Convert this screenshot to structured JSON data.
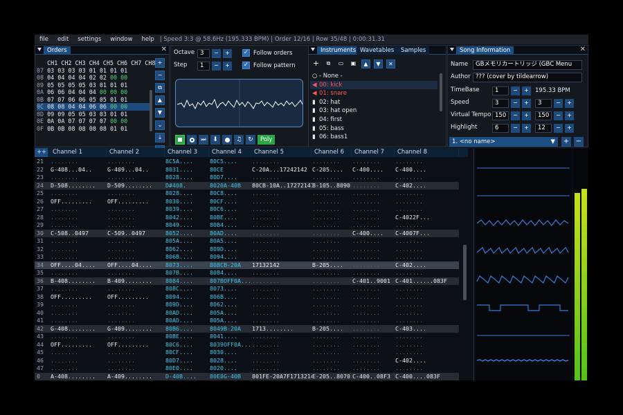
{
  "menu": {
    "items": [
      "file",
      "edit",
      "settings",
      "window",
      "help"
    ],
    "status": "| Speed 3:3 @ 58.6Hz (195.333 BPM) | Order 12/16 | Row 35/48 | 0:00:31.31"
  },
  "orders": {
    "tab": "Orders",
    "header": "   CH1 CH2 CH3 CH4 CH5 CH6 CH7 CH8",
    "rows": [
      [
        "07",
        "03",
        "03",
        "03",
        "03",
        "01",
        "01",
        "01",
        "01"
      ],
      [
        "08",
        "04",
        "04",
        "04",
        "04",
        "02",
        "02",
        "00",
        "00"
      ],
      [
        "09",
        "05",
        "05",
        "05",
        "05",
        "03",
        "01",
        "01",
        "01"
      ],
      [
        "0A",
        "06",
        "06",
        "04",
        "04",
        "04",
        "00",
        "00",
        "00"
      ],
      [
        "0B",
        "07",
        "07",
        "06",
        "06",
        "05",
        "05",
        "01",
        "01"
      ],
      [
        "0C",
        "08",
        "08",
        "04",
        "04",
        "06",
        "06",
        "00",
        "00"
      ],
      [
        "0D",
        "09",
        "09",
        "05",
        "05",
        "03",
        "03",
        "01",
        "01"
      ],
      [
        "0E",
        "0A",
        "0A",
        "07",
        "07",
        "07",
        "07",
        "00",
        "00"
      ],
      [
        "0F",
        "0B",
        "0B",
        "08",
        "08",
        "08",
        "08",
        "01",
        "01"
      ]
    ],
    "buttons": [
      "+",
      "−",
      "⧉",
      "▲",
      "▼",
      "⌄",
      "⤓",
      "↖"
    ]
  },
  "toolbar": {
    "octave_label": "Octave",
    "octave_value": "3",
    "step_label": "Step",
    "step_value": "1",
    "follow_orders": "Follow orders",
    "follow_pattern": "Follow pattern",
    "poly_label": "Poly"
  },
  "instruments": {
    "tabs": [
      "Instruments",
      "Wavetables",
      "Samples"
    ],
    "items": [
      {
        "label": "- None -",
        "color": "#e6eaf2"
      },
      {
        "label": "00: kick",
        "color": "#ff5a5a"
      },
      {
        "label": "01: snare",
        "color": "#ff5a5a"
      },
      {
        "label": "02: hat",
        "color": "#e6eaf2"
      },
      {
        "label": "03: hat open",
        "color": "#e6eaf2"
      },
      {
        "label": "04: first",
        "color": "#e6eaf2"
      },
      {
        "label": "05: bass",
        "color": "#e6eaf2"
      },
      {
        "label": "06: bass1",
        "color": "#e6eaf2"
      }
    ]
  },
  "song_info": {
    "tab": "Song Information",
    "name_label": "Name",
    "name_value": "GBメモリカートリッジ (GBC Menu",
    "author_label": "Author",
    "author_value": "??? (cover by tildearrow)",
    "timebase_label": "TimeBase",
    "timebase_value": "1",
    "bpm": "195.33 BPM",
    "speed_label": "Speed",
    "speed_1": "3",
    "speed_2": "3",
    "vtempo_label": "Virtual Tempo",
    "vtempo_1": "150",
    "vtempo_2": "150",
    "highlight_label": "Highlight",
    "highlight_1": "6",
    "highlight_2": "12",
    "subsong": "1. <no name>"
  },
  "pattern": {
    "corner": "++",
    "channels": [
      "Channel 1",
      "Channel 2",
      "Channel 3",
      "Channel 4",
      "Channel 5",
      "Channel 6",
      "Channel 7",
      "Channel 8"
    ],
    "rows": [
      {
        "n": "21",
        "c": [
          "........",
          "........",
          "8C5A....",
          "80C5....",
          "........",
          "........",
          "........",
          "........"
        ]
      },
      {
        "n": "22",
        "c": [
          "G-408...04..",
          "G-409...04..",
          "8031....",
          "80CE",
          "C-20A...17242142",
          "C-205....",
          "C-400....",
          "C-400...."
        ]
      },
      {
        "n": "23",
        "c": [
          "........",
          "........",
          "8028....",
          "80D7....",
          "........",
          "........",
          "........",
          "........"
        ]
      },
      {
        "n": "24",
        "c": [
          "D-508........",
          "D-509........",
          "D#408.",
          "8020A-40B",
          "80CB-10A..17272141",
          "B-105..8090",
          "........",
          "C-402...."
        ]
      },
      {
        "n": "25",
        "c": [
          "........",
          "........",
          "8028....",
          "80C8....",
          "........",
          "........",
          "........",
          "........"
        ]
      },
      {
        "n": "26",
        "c": [
          "OFF.........",
          "OFF.........",
          "8030....",
          "80CF....",
          "........",
          "........",
          "........",
          "........"
        ]
      },
      {
        "n": "27",
        "c": [
          "........",
          "........",
          "8039....",
          "80C6....",
          "........",
          "........",
          "........",
          "........"
        ]
      },
      {
        "n": "28",
        "c": [
          "........",
          "........",
          "8042....",
          "80BE....",
          "........",
          "........",
          "........",
          "C-4022F..."
        ]
      },
      {
        "n": "29",
        "c": [
          "........",
          "........",
          "8049....",
          "80B4....",
          "........",
          "........",
          "........",
          "........"
        ]
      },
      {
        "n": "30",
        "c": [
          "C-508..0497",
          "C-509..0497",
          "8052....",
          "80AD....",
          "........",
          "........",
          "C-400....",
          "C-4007F..."
        ]
      },
      {
        "n": "31",
        "c": [
          "........",
          "........",
          "805A....",
          "80A5....",
          "........",
          "........",
          "........",
          "........"
        ]
      },
      {
        "n": "32",
        "c": [
          "........",
          "........",
          "8062....",
          "809D....",
          "........",
          "........",
          "........",
          "........"
        ]
      },
      {
        "n": "33",
        "c": [
          "........",
          "........",
          "806B....",
          "8094....",
          "........",
          "........",
          "........",
          "........"
        ]
      },
      {
        "n": "34",
        "c": [
          "OFF....04....",
          "OFF....04....",
          "8073....",
          "808CB-20A",
          "17132142",
          "B-205....",
          "........",
          "C-402...."
        ]
      },
      {
        "n": "35",
        "c": [
          "........",
          "........",
          "807B....",
          "8084....",
          "........",
          "........",
          "........",
          "........"
        ]
      },
      {
        "n": "36",
        "c": [
          "B-408........",
          "B-409........",
          "8084....",
          "807BOFF0A......21..",
          "........",
          "........",
          "C-401..9001",
          "C-401......083F"
        ]
      },
      {
        "n": "37",
        "c": [
          "........",
          "........",
          "808C....",
          "8073....",
          "........",
          "........",
          "........",
          "........"
        ]
      },
      {
        "n": "38",
        "c": [
          "OFF.........",
          "OFF.........",
          "8094....",
          "806B....",
          "........",
          "........",
          "........",
          "........"
        ]
      },
      {
        "n": "39",
        "c": [
          "........",
          "........",
          "809D....",
          "8062....",
          "........",
          "........",
          "........",
          "........"
        ]
      },
      {
        "n": "40",
        "c": [
          "........",
          "........",
          "80AD....",
          "805A....",
          "........",
          "........",
          "........",
          "........"
        ]
      },
      {
        "n": "41",
        "c": [
          "........",
          "........",
          "80AD....",
          "805A....",
          "........",
          "........",
          "........",
          "........"
        ]
      },
      {
        "n": "42",
        "c": [
          "G-408........",
          "G-409........",
          "80B6....",
          "8049B-20A",
          "1713........",
          "B-205....",
          "........",
          "C-403...."
        ]
      },
      {
        "n": "43",
        "c": [
          "........",
          "........",
          "80BE....",
          "8041....",
          "........",
          "........",
          "........",
          "........"
        ]
      },
      {
        "n": "44",
        "c": [
          "OFF.........",
          "OFF.........",
          "80C6....",
          "8039OFF0A......21..",
          "........",
          "........",
          "........",
          "........"
        ]
      },
      {
        "n": "45",
        "c": [
          "........",
          "........",
          "80CF....",
          "8030....",
          "........",
          "........",
          "........",
          "........"
        ]
      },
      {
        "n": "46",
        "c": [
          "........",
          "........",
          "80D7....",
          "8028....",
          "........",
          "........",
          "........",
          "C-402...."
        ]
      },
      {
        "n": "47",
        "c": [
          "........",
          "........",
          "80E0....",
          "8020....",
          "........",
          "........",
          "........",
          "........"
        ]
      },
      {
        "n": "0",
        "c": [
          "A-408........",
          "A-409........",
          "D-40B....",
          "80E0G-40B",
          "801FE-20A7F17132142",
          "E-205..8070",
          "C-400..08F3",
          "C-400....083F"
        ]
      }
    ],
    "highlight_rows": [
      "24",
      "30",
      "36",
      "42",
      "0"
    ],
    "cursor_row": "34"
  },
  "colors": {
    "accent": "#1d4e82",
    "bg": "#0c0f16",
    "note": "#e8ecf3",
    "instrument": "#3fc6e8",
    "volume": "#f0f044",
    "effect": "#36b9d8",
    "effect_value": "#6ce063",
    "vu_meter": "#7fd41c"
  },
  "icons": {
    "play_controls": [
      "stop-icon",
      "play-icon",
      "play-from-start-icon",
      "step-icon",
      "record-icon",
      "metronome-icon",
      "repeat-icon"
    ],
    "instrument_tools": [
      "add-icon",
      "duplicate-icon",
      "open-icon",
      "save-icon",
      "move-up-icon",
      "move-down-icon",
      "delete-icon"
    ]
  }
}
